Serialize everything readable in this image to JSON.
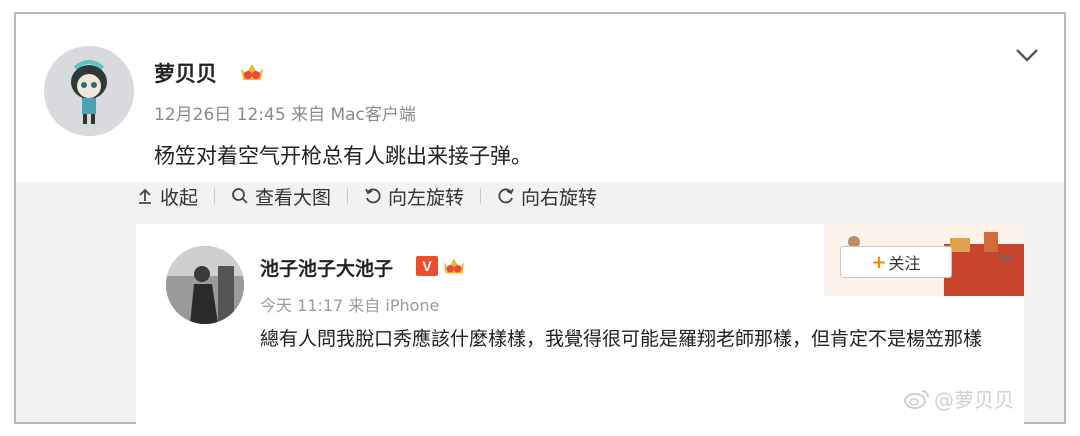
{
  "post": {
    "username": "萝贝贝",
    "meta": "12月26日 12:45 来自 Mac客户端",
    "text": "杨笠对着空气开枪总有人跳出来接子弹。"
  },
  "toolbar": {
    "collapse_label": "收起",
    "view_large_label": "查看大图",
    "rotate_left_label": "向左旋转",
    "rotate_right_label": "向右旋转"
  },
  "repost": {
    "username": "池子池子大池子",
    "verified_badge": "V",
    "follow_label": "关注",
    "follow_plus": "+",
    "meta": "今天 11:17 来自 iPhone",
    "text": "總有人問我脫口秀應該什麼樣樣，我覺得很可能是羅翔老師那樣，但肯定不是楊笠那樣"
  },
  "watermark": {
    "text": "@萝贝贝"
  },
  "colors": {
    "accent_orange": "#ff8200",
    "verified_red": "#e8502f",
    "gray_bg": "#f2f2f2"
  }
}
